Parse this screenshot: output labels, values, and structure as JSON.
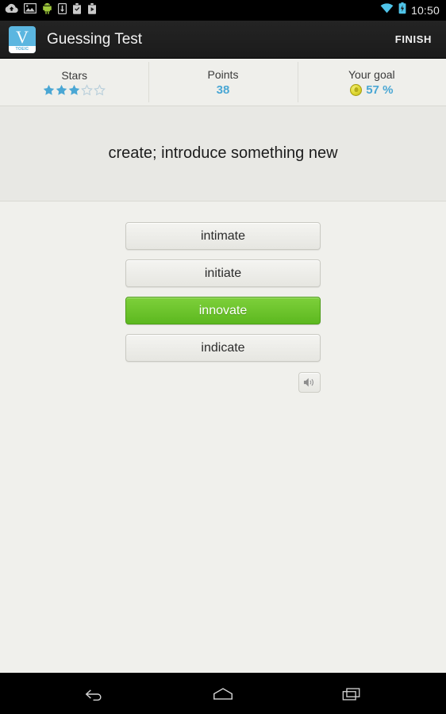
{
  "statusbar": {
    "time": "10:50",
    "left_icons": [
      "cloud-upload-icon",
      "gallery-image-icon",
      "android-robot-icon",
      "download-box-icon",
      "checkbox-app-icon",
      "play-store-bag-icon"
    ],
    "right_icons": [
      "wifi-icon",
      "battery-charging-icon"
    ]
  },
  "actionbar": {
    "app_icon_letter": "V",
    "app_icon_caption": "TOEIC",
    "title": "Guessing Test",
    "finish_label": "FINISH"
  },
  "stats": {
    "stars": {
      "label": "Stars",
      "filled": 3,
      "total": 5
    },
    "points": {
      "label": "Points",
      "value": "38"
    },
    "goal": {
      "label": "Your goal",
      "value": "57 %",
      "icon": "gold-coin-icon"
    }
  },
  "question": {
    "text": "create; introduce something new"
  },
  "answers": [
    {
      "label": "intimate",
      "state": "normal"
    },
    {
      "label": "initiate",
      "state": "normal"
    },
    {
      "label": "innovate",
      "state": "correct"
    },
    {
      "label": "indicate",
      "state": "normal"
    }
  ],
  "speaker": {
    "icon": "speaker-volume-icon"
  },
  "navbar": {
    "back": "back-icon",
    "home": "home-icon",
    "recents": "recent-apps-icon"
  },
  "colors": {
    "accent_blue": "#4aa7d4",
    "correct_green": "#5cb81f",
    "coin_gold": "#ddd62f",
    "panel_bg": "#e8e8e4",
    "content_bg": "#f0f0ec",
    "actionbar_bg": "#1f1f1f"
  }
}
